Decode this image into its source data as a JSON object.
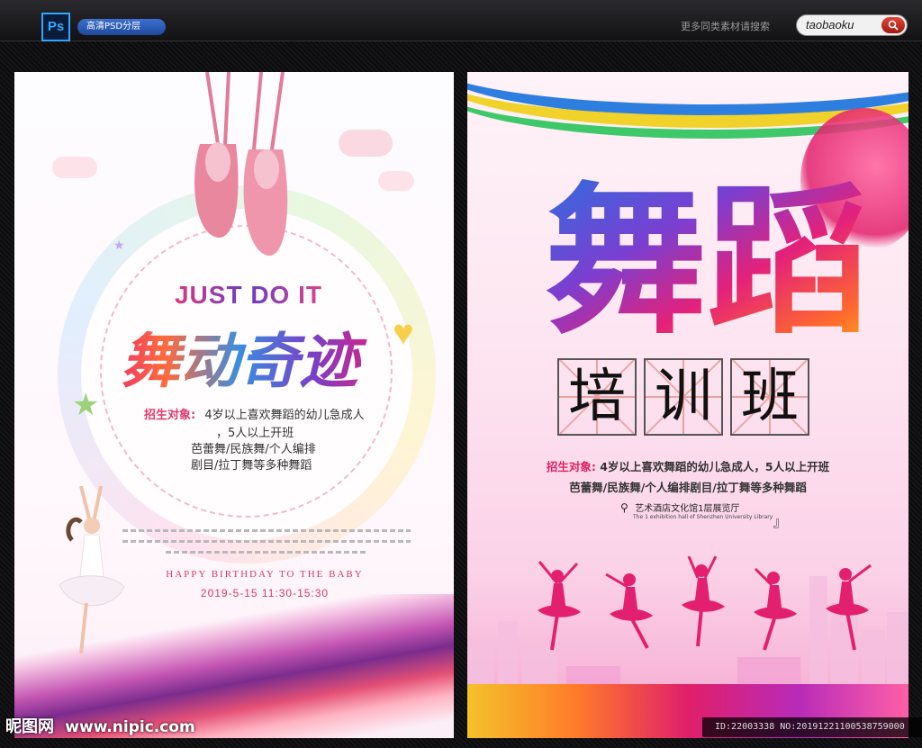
{
  "header": {
    "app_badge": "Ps",
    "psd_label": "高清PSD分层",
    "search_hint": "更多同类素材请搜索",
    "search_value": "taobaoku",
    "search_icon": "magnifier-icon"
  },
  "poster1": {
    "slogan": "JUST DO IT",
    "title": "舞动奇迹",
    "recruit_label": "招生对象:",
    "recruit_line1": "4岁以上喜欢舞蹈的幼儿急成人",
    "recruit_line2": "，5人以上开班",
    "recruit_line3": "芭蕾舞/民族舞/个人编排",
    "recruit_line4": "剧目/拉丁舞等多种舞蹈",
    "birthday": "HAPPY BIRTHDAY TO THE BABY",
    "datetime": "2019-5-15 11:30-15:30"
  },
  "poster2": {
    "title": "舞蹈",
    "subtitle_chars": [
      "培",
      "训",
      "班"
    ],
    "recruit_label": "招生对象:",
    "recruit_line1": "4岁以上喜欢舞蹈的幼儿急成人，5人以上开班",
    "recruit_line2": "芭蕾舞/民族舞/个人编排剧目/拉丁舞等多种舞蹈",
    "venue": "艺术酒店文化馆1层展览厅",
    "venue_en": "The 1 exhibition hall of Shenzhen University Library",
    "quote_mark": "』"
  },
  "footer": {
    "watermark_cn": "昵图网",
    "watermark_url": "www.nipic.com",
    "id_text": "ID:22003338 NO:20191221100538759000"
  },
  "colors": {
    "accent_pink": "#e0205f",
    "ps_blue": "#31a8ff",
    "frame_dark": "#0e0e10"
  }
}
